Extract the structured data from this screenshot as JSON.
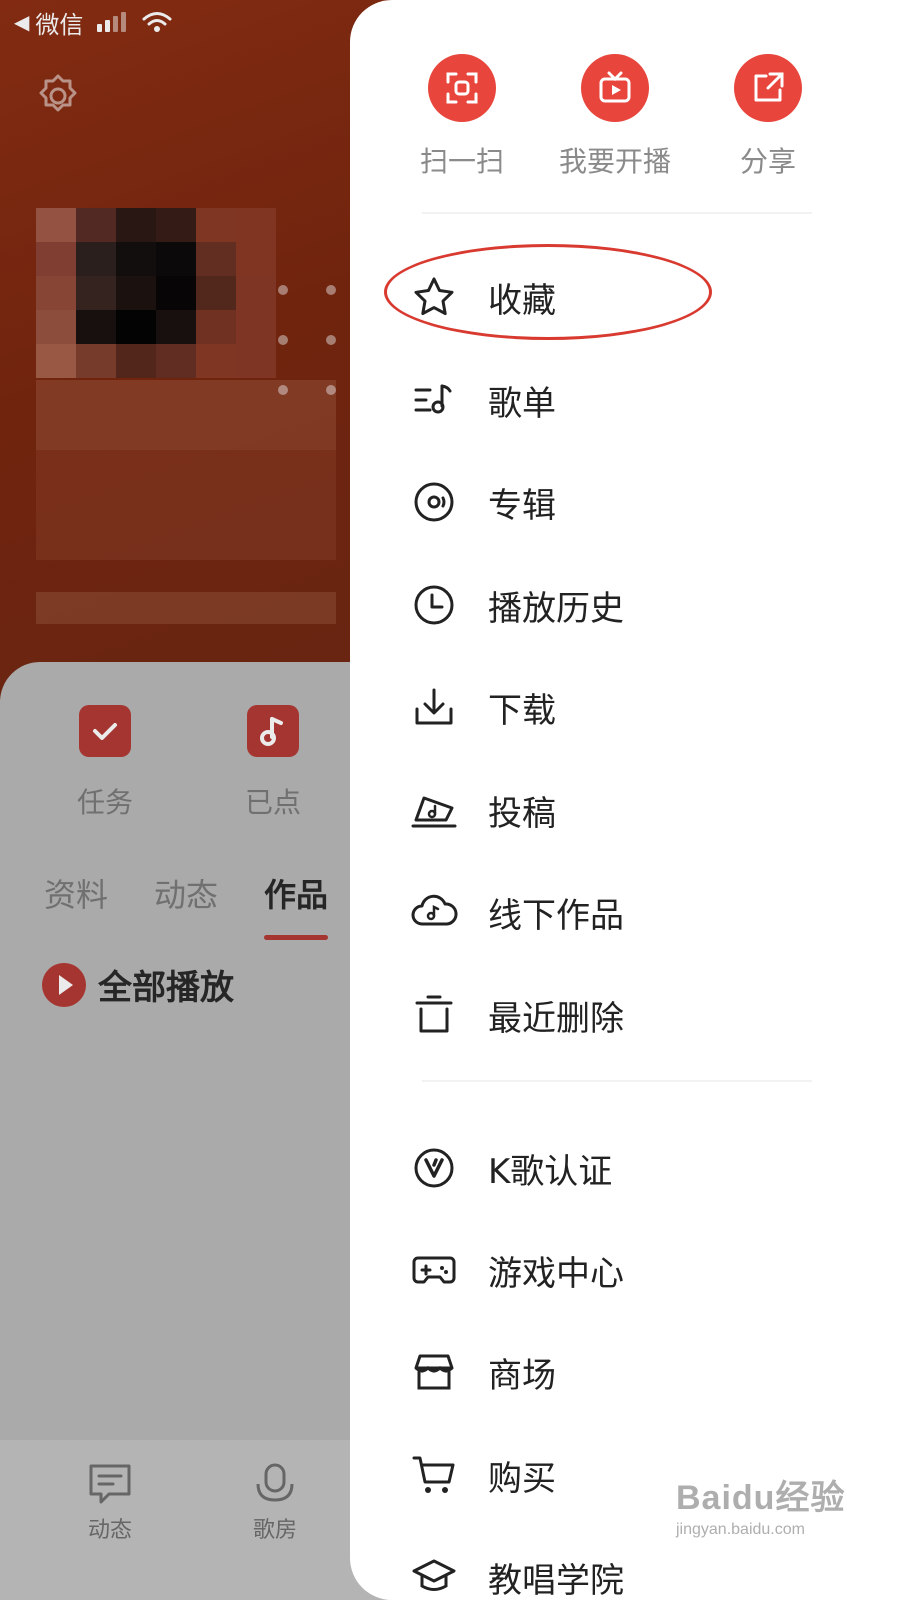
{
  "status_bar": {
    "back_app": "微信",
    "back_arrow": "◀"
  },
  "profile": {
    "quick_actions": [
      {
        "label": "任务",
        "icon": "calendar-check-icon"
      },
      {
        "label": "已点",
        "icon": "music-note-icon"
      }
    ],
    "tabs": [
      {
        "label": "资料"
      },
      {
        "label": "动态"
      },
      {
        "label": "作品",
        "active": true
      }
    ],
    "play_all_label": "全部播放",
    "bottom_nav": [
      {
        "label": "动态",
        "icon": "message-icon"
      },
      {
        "label": "歌房",
        "icon": "microphone-icon"
      }
    ]
  },
  "drawer": {
    "top_actions": [
      {
        "label": "扫一扫",
        "icon": "scan-icon"
      },
      {
        "label": "我要开播",
        "icon": "tv-play-icon"
      },
      {
        "label": "分享",
        "icon": "share-icon"
      }
    ],
    "menu_group_1": [
      {
        "label": "收藏",
        "icon": "star-icon",
        "highlighted": true
      },
      {
        "label": "歌单",
        "icon": "playlist-icon"
      },
      {
        "label": "专辑",
        "icon": "disc-icon"
      },
      {
        "label": "播放历史",
        "icon": "clock-icon"
      },
      {
        "label": "下载",
        "icon": "download-icon"
      },
      {
        "label": "投稿",
        "icon": "submit-icon"
      },
      {
        "label": "线下作品",
        "icon": "cloud-music-icon"
      },
      {
        "label": "最近删除",
        "icon": "trash-icon"
      }
    ],
    "menu_group_2": [
      {
        "label": "K歌认证",
        "icon": "verified-v-icon"
      },
      {
        "label": "游戏中心",
        "icon": "gamepad-icon"
      },
      {
        "label": "商场",
        "icon": "store-icon"
      },
      {
        "label": "购买",
        "icon": "cart-icon"
      },
      {
        "label": "教唱学院",
        "icon": "graduation-icon"
      }
    ]
  },
  "watermark": {
    "main": "Baidu经验",
    "sub": "jingyan.baidu.com"
  },
  "colors": {
    "accent": "#e8453c",
    "highlight_ring": "#d93a30",
    "hero_bg": "#7a2810"
  }
}
